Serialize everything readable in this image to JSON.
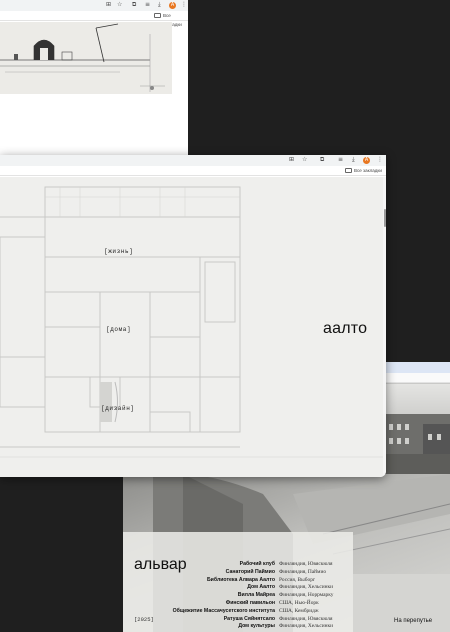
{
  "browser": {
    "bookmarks_label": "Все закладки",
    "avatar_letter": "A"
  },
  "window3": {
    "title": "альвар",
    "year": "[2025]",
    "crossroad_text": "На перепутье",
    "works": [
      {
        "name": "Рабочий клуб",
        "place": "Финляндия, Ювяскюля"
      },
      {
        "name": "Санаторий Паймио",
        "place": "Финляндия, Паймио"
      },
      {
        "name": "Библиотека Алвара Аалто",
        "place": "Россия, Выборг"
      },
      {
        "name": "Дом Аалто",
        "place": "Финляндия, Хельсинки"
      },
      {
        "name": "Вилла Майреа",
        "place": "Финляндия, Норрмарку"
      },
      {
        "name": "Финский павильон",
        "place": "США, Нью-Йорк"
      },
      {
        "name": "Общежитие Массачусетского института",
        "place": "США, Кембридж"
      },
      {
        "name": "Ратуша Сяйнятсало",
        "place": "Финляндия, Ювяскюля"
      },
      {
        "name": "Дом культуры",
        "place": "Финляндия, Хельсинки"
      }
    ]
  },
  "window2": {
    "nav": {
      "life": "[жизнь]",
      "houses": "[дома]",
      "design": "[дизайн]"
    },
    "brand": "аалто"
  }
}
